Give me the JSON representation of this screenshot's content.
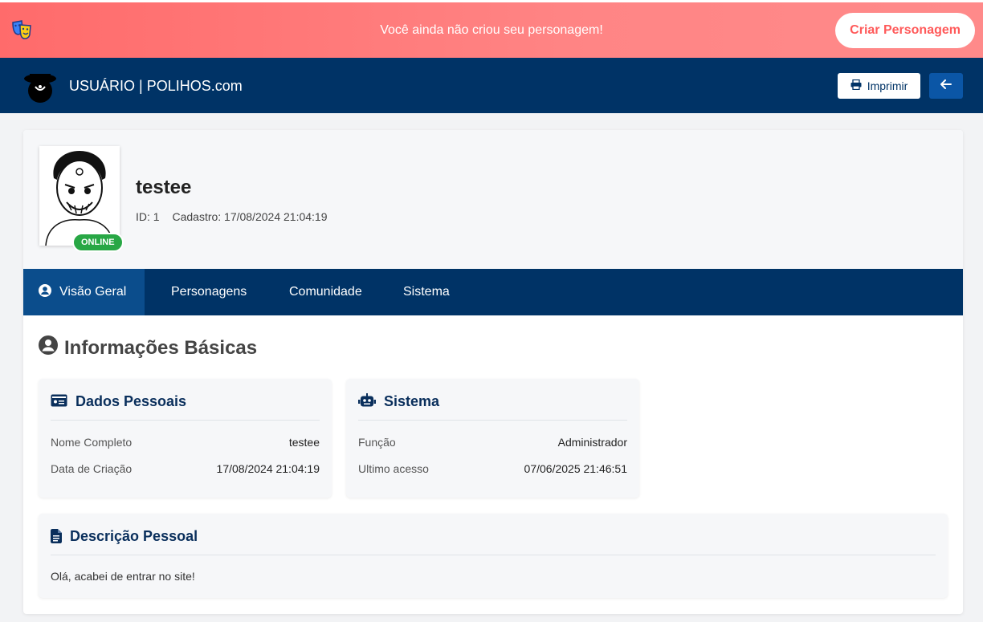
{
  "alert": {
    "message": "Você ainda não criou seu personagem!",
    "cta_label": "Criar Personagem"
  },
  "navbar": {
    "title": "USUÁRIO | POLIHOS.com",
    "print_label": "Imprimir",
    "back_icon": "arrow-left-icon"
  },
  "profile": {
    "username": "testee",
    "id_text": "ID: 1",
    "created_text": "Cadastro: 17/08/2024 21:04:19",
    "status_badge": "ONLINE"
  },
  "tabs": [
    {
      "label": "Visão Geral",
      "icon": "user-circle-icon",
      "active": true
    },
    {
      "label": "Personagens",
      "active": false
    },
    {
      "label": "Comunidade",
      "active": false
    },
    {
      "label": "Sistema",
      "active": false
    }
  ],
  "section": {
    "title": "Informações Básicas"
  },
  "personal": {
    "title": "Dados Pessoais",
    "rows": [
      {
        "key": "Nome Completo",
        "value": "testee"
      },
      {
        "key": "Data de Criação",
        "value": "17/08/2024 21:04:19"
      }
    ]
  },
  "system": {
    "title": "Sistema",
    "rows": [
      {
        "key": "Função",
        "value": "Administrador"
      },
      {
        "key": "Ultimo acesso",
        "value": "07/06/2025 21:46:51"
      }
    ]
  },
  "description": {
    "title": "Descrição Pessoal",
    "text": "Olá, acabei de entrar no site!"
  },
  "colors": {
    "alert_bg": "#ff6b6b",
    "navbar_bg": "#003366",
    "tab_active_bg": "#0b4d8c",
    "online_badge": "#28a745",
    "back_button": "#0b56a6"
  }
}
